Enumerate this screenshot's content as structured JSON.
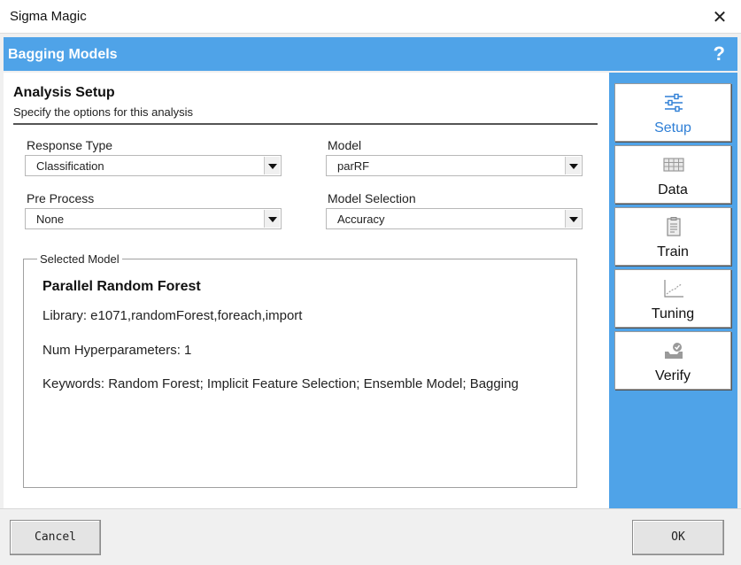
{
  "window": {
    "title": "Sigma Magic",
    "close_glyph": "✕"
  },
  "header": {
    "title": "Bagging Models",
    "help_glyph": "?"
  },
  "setup": {
    "title": "Analysis Setup",
    "subtitle": "Specify the options for this analysis"
  },
  "fields": {
    "response_type": {
      "label": "Response Type",
      "value": "Classification"
    },
    "model": {
      "label": "Model",
      "value": "parRF"
    },
    "pre_process": {
      "label": "Pre Process",
      "value": "None"
    },
    "model_selection": {
      "label": "Model Selection",
      "value": "Accuracy"
    }
  },
  "selected_model": {
    "group_label": "Selected Model",
    "name": "Parallel Random Forest",
    "library": "Library: e1071,randomForest,foreach,import",
    "hyperparameters": "Num Hyperparameters: 1",
    "keywords": "Keywords: Random Forest; Implicit Feature Selection; Ensemble Model; Bagging"
  },
  "nav": [
    {
      "label": "Setup",
      "icon": "sliders-icon",
      "active": true
    },
    {
      "label": "Data",
      "icon": "table-icon",
      "active": false
    },
    {
      "label": "Train",
      "icon": "clipboard-icon",
      "active": false
    },
    {
      "label": "Tuning",
      "icon": "line-chart-icon",
      "active": false
    },
    {
      "label": "Verify",
      "icon": "verify-icon",
      "active": false
    }
  ],
  "buttons": {
    "cancel": "Cancel",
    "ok": "OK"
  },
  "colors": {
    "accent": "#4fa3e8",
    "active_nav_text": "#2f7fd6"
  }
}
